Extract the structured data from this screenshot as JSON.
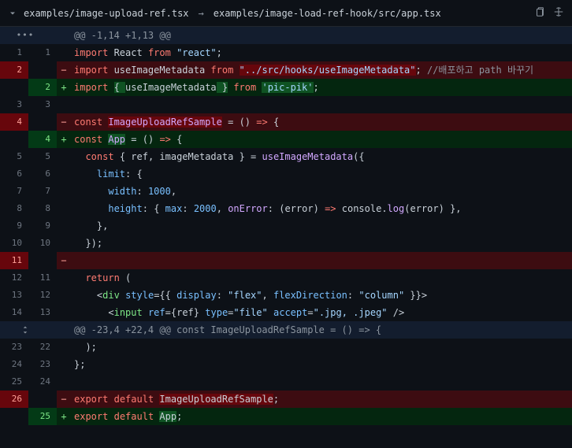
{
  "header": {
    "from_path": "examples/image-upload-ref.tsx",
    "to_path": "examples/image-load-ref-hook/src/app.tsx"
  },
  "rows": [
    {
      "type": "hunk",
      "dots": true,
      "text": "@@ -1,14 +1,13 @@"
    },
    {
      "type": "ctx",
      "old": "1",
      "new": "1",
      "tokens": [
        [
          "kw",
          "import"
        ],
        [
          "id",
          " React "
        ],
        [
          "kw",
          "from"
        ],
        [
          "id",
          " "
        ],
        [
          "str",
          "\"react\""
        ],
        [
          "punc",
          ";"
        ]
      ]
    },
    {
      "type": "del",
      "old": "2",
      "tokens": [
        [
          "kw",
          "import"
        ],
        [
          "id",
          " useImageMetadata "
        ],
        [
          "kw",
          "from"
        ],
        [
          "id",
          " "
        ],
        [
          "str_hl",
          "\"../src/hooks/useImageMetadata\""
        ],
        [
          "punc",
          ";"
        ],
        [
          "id",
          " "
        ],
        [
          "cmt",
          "//배포하고 path 바꾸기"
        ]
      ]
    },
    {
      "type": "add",
      "new": "2",
      "tokens": [
        [
          "kw",
          "import"
        ],
        [
          "id",
          " "
        ],
        [
          "punc_hl",
          "{ "
        ],
        [
          "id",
          "useImageMetadata"
        ],
        [
          "punc_hl",
          " }"
        ],
        [
          "id",
          " "
        ],
        [
          "kw",
          "from"
        ],
        [
          "id",
          " "
        ],
        [
          "str_hl",
          "'pic-pik'"
        ],
        [
          "punc",
          ";"
        ]
      ]
    },
    {
      "type": "ctx",
      "old": "3",
      "new": "3",
      "tokens": []
    },
    {
      "type": "del",
      "old": "4",
      "tokens": [
        [
          "kw",
          "const"
        ],
        [
          "id",
          " "
        ],
        [
          "fn_hl",
          "ImageUploadRefSample"
        ],
        [
          "id",
          " "
        ],
        [
          "punc",
          "="
        ],
        [
          "id",
          " "
        ],
        [
          "punc",
          "()"
        ],
        [
          "id",
          " "
        ],
        [
          "kw",
          "=>"
        ],
        [
          "id",
          " "
        ],
        [
          "punc",
          "{"
        ]
      ]
    },
    {
      "type": "add",
      "new": "4",
      "tokens": [
        [
          "kw",
          "const"
        ],
        [
          "id",
          " "
        ],
        [
          "fn_hl",
          "App"
        ],
        [
          "id",
          " "
        ],
        [
          "punc",
          "="
        ],
        [
          "id",
          " "
        ],
        [
          "punc",
          "()"
        ],
        [
          "id",
          " "
        ],
        [
          "kw",
          "=>"
        ],
        [
          "id",
          " "
        ],
        [
          "punc",
          "{"
        ]
      ]
    },
    {
      "type": "ctx",
      "old": "5",
      "new": "5",
      "tokens": [
        [
          "id",
          "  "
        ],
        [
          "kw",
          "const"
        ],
        [
          "id",
          " "
        ],
        [
          "punc",
          "{"
        ],
        [
          "id",
          " ref"
        ],
        [
          "punc",
          ","
        ],
        [
          "id",
          " imageMetadata "
        ],
        [
          "punc",
          "}"
        ],
        [
          "id",
          " "
        ],
        [
          "punc",
          "="
        ],
        [
          "id",
          " "
        ],
        [
          "fn",
          "useImageMetadata"
        ],
        [
          "punc",
          "({"
        ]
      ]
    },
    {
      "type": "ctx",
      "old": "6",
      "new": "6",
      "tokens": [
        [
          "id",
          "    "
        ],
        [
          "prop",
          "limit"
        ],
        [
          "punc",
          ":"
        ],
        [
          "id",
          " "
        ],
        [
          "punc",
          "{"
        ]
      ]
    },
    {
      "type": "ctx",
      "old": "7",
      "new": "7",
      "tokens": [
        [
          "id",
          "      "
        ],
        [
          "prop",
          "width"
        ],
        [
          "punc",
          ":"
        ],
        [
          "id",
          " "
        ],
        [
          "num",
          "1000"
        ],
        [
          "punc",
          ","
        ]
      ]
    },
    {
      "type": "ctx",
      "old": "8",
      "new": "8",
      "tokens": [
        [
          "id",
          "      "
        ],
        [
          "prop",
          "height"
        ],
        [
          "punc",
          ":"
        ],
        [
          "id",
          " "
        ],
        [
          "punc",
          "{"
        ],
        [
          "id",
          " "
        ],
        [
          "prop",
          "max"
        ],
        [
          "punc",
          ":"
        ],
        [
          "id",
          " "
        ],
        [
          "num",
          "2000"
        ],
        [
          "punc",
          ","
        ],
        [
          "id",
          " "
        ],
        [
          "fn",
          "onError"
        ],
        [
          "punc",
          ":"
        ],
        [
          "id",
          " "
        ],
        [
          "punc",
          "("
        ],
        [
          "id",
          "error"
        ],
        [
          "punc",
          ")"
        ],
        [
          "id",
          " "
        ],
        [
          "kw",
          "=>"
        ],
        [
          "id",
          " console"
        ],
        [
          "punc",
          "."
        ],
        [
          "fn",
          "log"
        ],
        [
          "punc",
          "("
        ],
        [
          "id",
          "error"
        ],
        [
          "punc",
          ")"
        ],
        [
          "id",
          " "
        ],
        [
          "punc",
          "},"
        ]
      ]
    },
    {
      "type": "ctx",
      "old": "9",
      "new": "9",
      "tokens": [
        [
          "id",
          "    "
        ],
        [
          "punc",
          "},"
        ]
      ]
    },
    {
      "type": "ctx",
      "old": "10",
      "new": "10",
      "tokens": [
        [
          "id",
          "  "
        ],
        [
          "punc",
          "});"
        ]
      ]
    },
    {
      "type": "del",
      "old": "11",
      "tokens": []
    },
    {
      "type": "ctx",
      "old": "12",
      "new": "11",
      "tokens": [
        [
          "id",
          "  "
        ],
        [
          "kw",
          "return"
        ],
        [
          "id",
          " "
        ],
        [
          "punc",
          "("
        ]
      ]
    },
    {
      "type": "ctx",
      "old": "13",
      "new": "12",
      "tokens": [
        [
          "id",
          "    "
        ],
        [
          "punc",
          "<"
        ],
        [
          "jsx",
          "div"
        ],
        [
          "id",
          " "
        ],
        [
          "prop",
          "style"
        ],
        [
          "punc",
          "="
        ],
        [
          "punc",
          "{{"
        ],
        [
          "id",
          " "
        ],
        [
          "prop",
          "display"
        ],
        [
          "punc",
          ":"
        ],
        [
          "id",
          " "
        ],
        [
          "str",
          "\"flex\""
        ],
        [
          "punc",
          ","
        ],
        [
          "id",
          " "
        ],
        [
          "prop",
          "flexDirection"
        ],
        [
          "punc",
          ":"
        ],
        [
          "id",
          " "
        ],
        [
          "str",
          "\"column\""
        ],
        [
          "id",
          " "
        ],
        [
          "punc",
          "}}>"
        ]
      ]
    },
    {
      "type": "ctx",
      "old": "14",
      "new": "13",
      "tokens": [
        [
          "id",
          "      "
        ],
        [
          "punc",
          "<"
        ],
        [
          "jsx",
          "input"
        ],
        [
          "id",
          " "
        ],
        [
          "prop",
          "ref"
        ],
        [
          "punc",
          "="
        ],
        [
          "punc",
          "{"
        ],
        [
          "id",
          "ref"
        ],
        [
          "punc",
          "}"
        ],
        [
          "id",
          " "
        ],
        [
          "prop",
          "type"
        ],
        [
          "punc",
          "="
        ],
        [
          "str",
          "\"file\""
        ],
        [
          "id",
          " "
        ],
        [
          "prop",
          "accept"
        ],
        [
          "punc",
          "="
        ],
        [
          "str",
          "\".jpg, .jpeg\""
        ],
        [
          "id",
          " "
        ],
        [
          "punc",
          "/>"
        ]
      ]
    },
    {
      "type": "hunk",
      "expand": true,
      "text": "@@ -23,4 +22,4 @@ const ImageUploadRefSample = () => {"
    },
    {
      "type": "ctx",
      "old": "23",
      "new": "22",
      "tokens": [
        [
          "id",
          "  "
        ],
        [
          "punc",
          ");"
        ]
      ]
    },
    {
      "type": "ctx",
      "old": "24",
      "new": "23",
      "tokens": [
        [
          "punc",
          "};"
        ]
      ]
    },
    {
      "type": "ctx",
      "old": "25",
      "new": "24",
      "tokens": []
    },
    {
      "type": "del",
      "old": "26",
      "tokens": [
        [
          "kw",
          "export"
        ],
        [
          "id",
          " "
        ],
        [
          "kw",
          "default"
        ],
        [
          "id",
          " "
        ],
        [
          "id_hl",
          "ImageUploadRefSample"
        ],
        [
          "punc",
          ";"
        ]
      ]
    },
    {
      "type": "add",
      "new": "25",
      "tokens": [
        [
          "kw",
          "export"
        ],
        [
          "id",
          " "
        ],
        [
          "kw",
          "default"
        ],
        [
          "id",
          " "
        ],
        [
          "id_hl",
          "App"
        ],
        [
          "punc",
          ";"
        ]
      ]
    }
  ]
}
